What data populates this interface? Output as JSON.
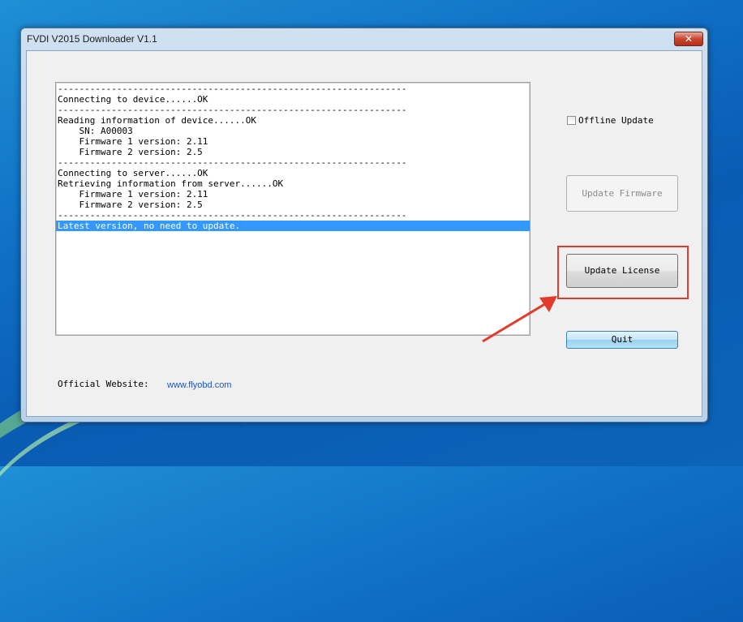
{
  "window": {
    "title": "FVDI  V2015 Downloader V1.1",
    "close_glyph": "✕"
  },
  "log": {
    "lines": [
      "-----------------------------------------------------------------",
      "Connecting to device......OK",
      "-----------------------------------------------------------------",
      "Reading information of device......OK",
      "    SN: A00003",
      "    Firmware 1 version: 2.11",
      "    Firmware 2 version: 2.5",
      "-----------------------------------------------------------------",
      "Connecting to server......OK",
      "Retrieving information from server......OK",
      "    Firmware 1 version: 2.11",
      "    Firmware 2 version: 2.5",
      "-----------------------------------------------------------------",
      "Latest version, no need to update."
    ],
    "selected_index": 13
  },
  "controls": {
    "offline_label": "Offline Update",
    "offline_checked": false,
    "update_firmware_label": "Update Firmware",
    "update_firmware_enabled": false,
    "update_license_label": "Update License",
    "quit_label": "Quit"
  },
  "footer": {
    "website_label": "Official Website:",
    "website_link": "www.flyobd.com"
  },
  "colors": {
    "highlight": "#e23b2e",
    "selection": "#3399ff",
    "link": "#1a55c8"
  }
}
